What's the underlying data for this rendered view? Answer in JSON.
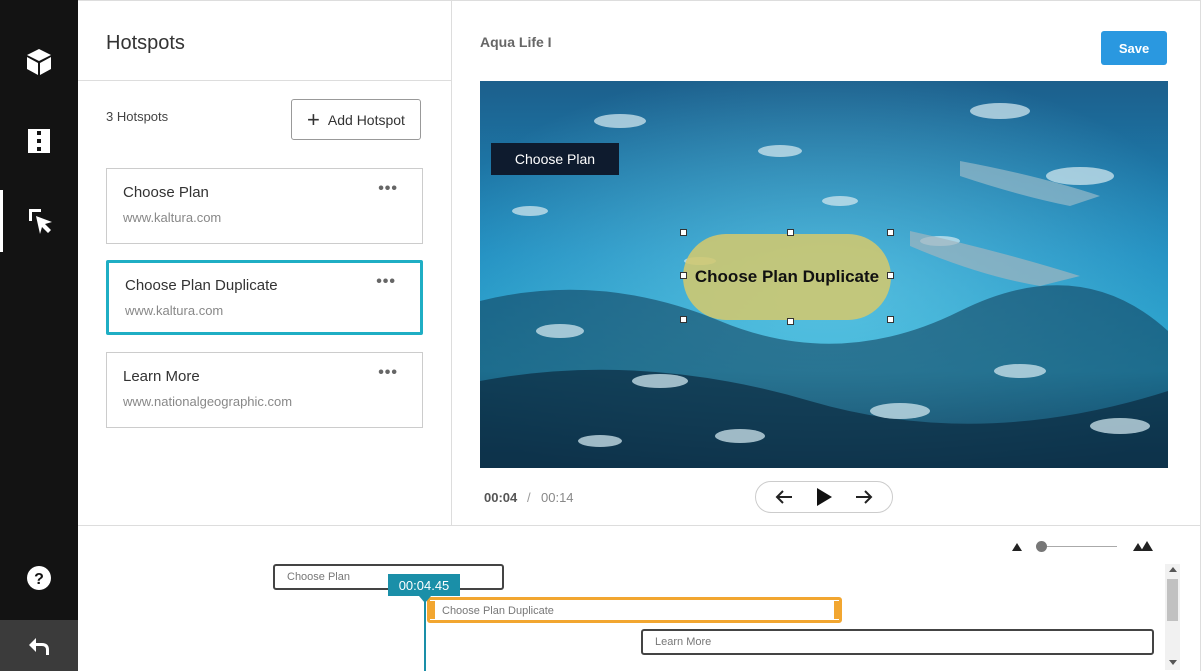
{
  "rail": {
    "icons": [
      "cube-icon",
      "film-strip-icon",
      "cursor-select-icon",
      "help-icon",
      "back-arrow-icon"
    ]
  },
  "hotspots_panel": {
    "title": "Hotspots",
    "count_label": "3 Hotspots",
    "add_button_label": "Add Hotspot",
    "items": [
      {
        "name": "Choose Plan",
        "url": "www.kaltura.com",
        "more": "•••"
      },
      {
        "name": "Choose Plan Duplicate",
        "url": "www.kaltura.com",
        "more": "•••"
      },
      {
        "name": "Learn More",
        "url": "www.nationalgeographic.com",
        "more": "•••"
      }
    ]
  },
  "editor": {
    "video_title": "Aqua Life I",
    "save_label": "Save",
    "overlay_dark_label": "Choose Plan",
    "overlay_oval_label": "Choose Plan Duplicate",
    "current_time": "00:04",
    "separator": "/",
    "total_time": "00:14"
  },
  "timeline": {
    "playhead_label": "00:04.45",
    "bars": [
      "Choose Plan",
      "Choose Plan Duplicate",
      "Learn More"
    ]
  },
  "colors": {
    "accent": "#1faec4",
    "save": "#2a98e0",
    "selected_bar": "#f2a630",
    "playhead": "#1a8fa8"
  }
}
